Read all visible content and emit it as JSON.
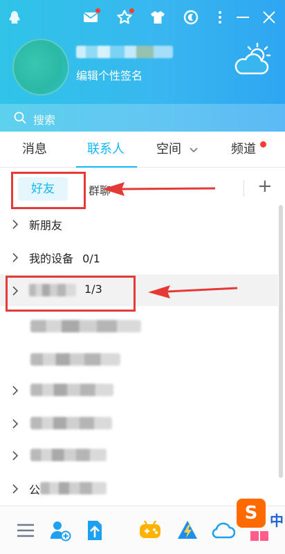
{
  "header": {
    "signature": "编辑个性签名",
    "search_placeholder": "搜索",
    "colors": {
      "gradient_start": "#2fc4e8",
      "gradient_end": "#2ea6f2"
    }
  },
  "titlebar": {
    "icons": [
      "qq-penguin-icon",
      "mail-icon",
      "star-icon",
      "shirt-icon",
      "moon-icon",
      "more-icon",
      "minimize-icon",
      "close-icon"
    ]
  },
  "tabs": [
    {
      "label": "消息"
    },
    {
      "label": "联系人"
    },
    {
      "label": "空间"
    },
    {
      "label": "频道"
    }
  ],
  "subtabs": {
    "friends": "好友",
    "groups": "群聊"
  },
  "list": {
    "new_friends": "新朋友",
    "my_devices": "我的设备",
    "my_devices_count": "0/1",
    "group3_count": "1/3",
    "partial_char": "公"
  },
  "bottombar": {
    "icons": [
      "menu-icon",
      "add-contact-icon",
      "upload-icon",
      "game-icon",
      "lightning-icon",
      "cloud-icon",
      "apps-icon"
    ],
    "ime_logo": "S",
    "ime_lang": "中"
  },
  "accent": "#12b7f5",
  "annotation_color": "#e53935"
}
